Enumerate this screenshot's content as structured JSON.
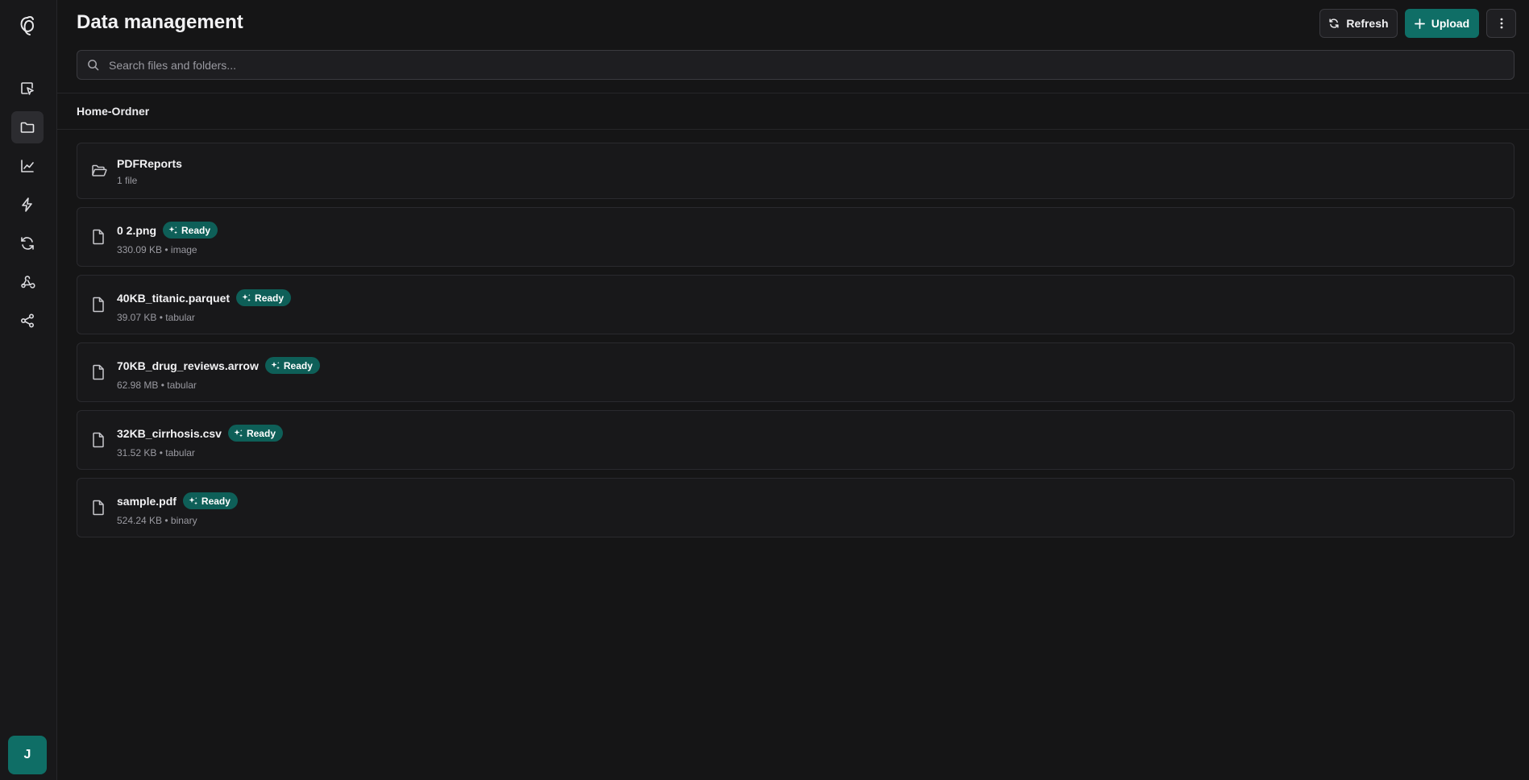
{
  "header": {
    "title": "Data management",
    "refresh_label": "Refresh",
    "upload_label": "Upload"
  },
  "search": {
    "placeholder": "Search files and folders..."
  },
  "breadcrumb": "Home-Ordner",
  "user": {
    "initial": "J"
  },
  "sidebar": {
    "items": [
      {
        "icon": "select-pointer-icon"
      },
      {
        "icon": "folder-icon",
        "active": true
      },
      {
        "icon": "line-chart-icon"
      },
      {
        "icon": "lightning-icon"
      },
      {
        "icon": "refresh-cycle-icon"
      },
      {
        "icon": "webhook-icon"
      },
      {
        "icon": "share-icon"
      }
    ]
  },
  "folders": [
    {
      "name": "PDFReports",
      "meta": "1 file"
    }
  ],
  "files": [
    {
      "name": "0 2.png",
      "status": "Ready",
      "meta": "330.09 KB • image"
    },
    {
      "name": "40KB_titanic.parquet",
      "status": "Ready",
      "meta": "39.07 KB • tabular"
    },
    {
      "name": "70KB_drug_reviews.arrow",
      "status": "Ready",
      "meta": "62.98 MB • tabular"
    },
    {
      "name": "32KB_cirrhosis.csv",
      "status": "Ready",
      "meta": "31.52 KB • tabular"
    },
    {
      "name": "sample.pdf",
      "status": "Ready",
      "meta": "524.24 KB • binary"
    }
  ],
  "colors": {
    "accent": "#0f6e66",
    "background": "#151516",
    "badge": "#0e5f58"
  }
}
